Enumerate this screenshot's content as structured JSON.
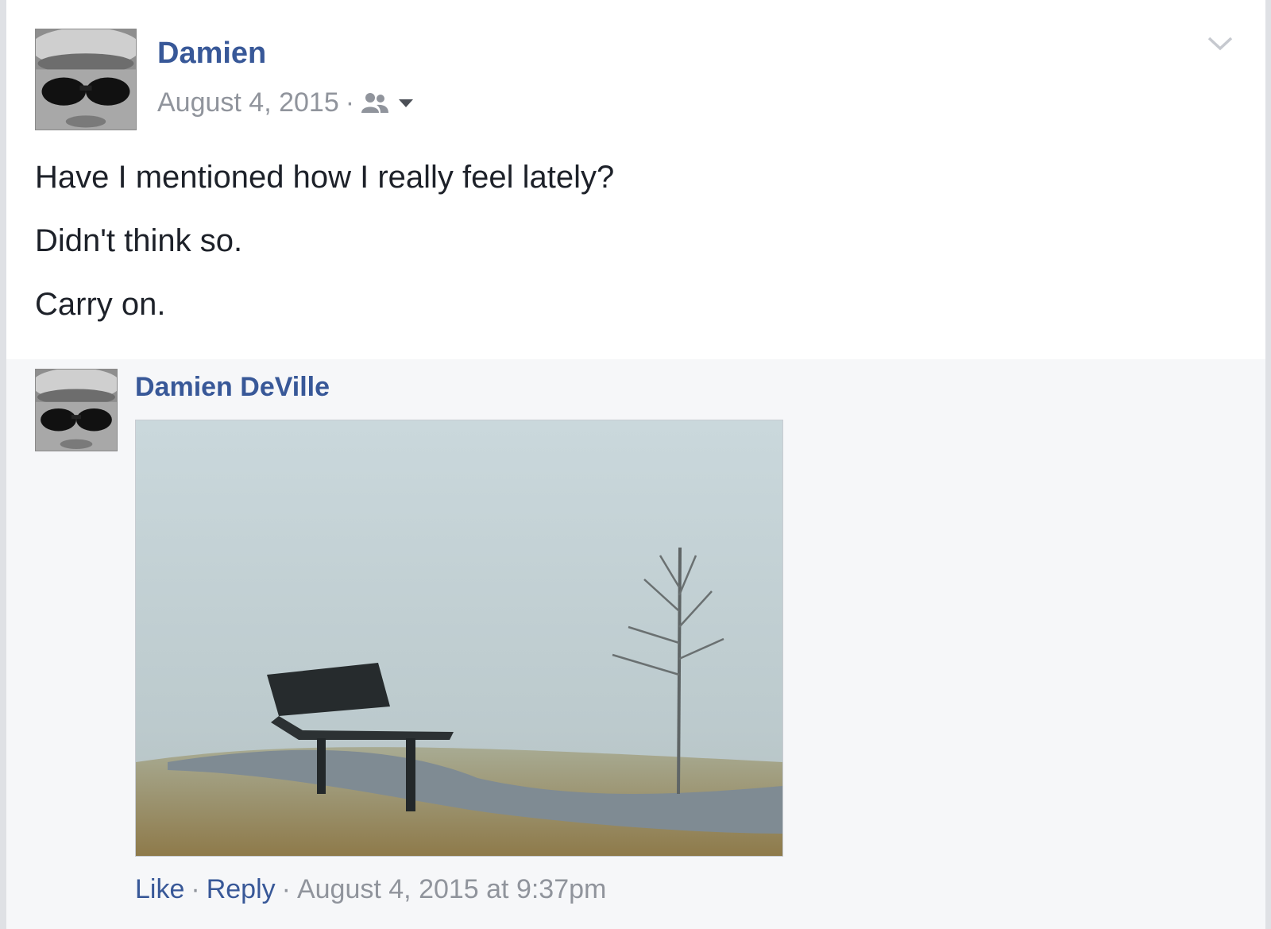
{
  "post": {
    "author": "Damien",
    "date": "August 4, 2015",
    "separator": "·",
    "body": [
      "Have I mentioned how I really feel lately?",
      "Didn't think so.",
      "Carry on."
    ]
  },
  "comment": {
    "author": "Damien DeVille",
    "like_label": "Like",
    "reply_label": "Reply",
    "separator": "·",
    "timestamp": "August 4, 2015 at 9:37pm"
  },
  "icons": {
    "audience": "friends-icon",
    "audience_caret": "caret-down-icon",
    "options": "chevron-down-icon"
  },
  "colors": {
    "link": "#385898",
    "meta": "#90949c",
    "text": "#1d2129",
    "comment_bg": "#f6f7f9"
  }
}
